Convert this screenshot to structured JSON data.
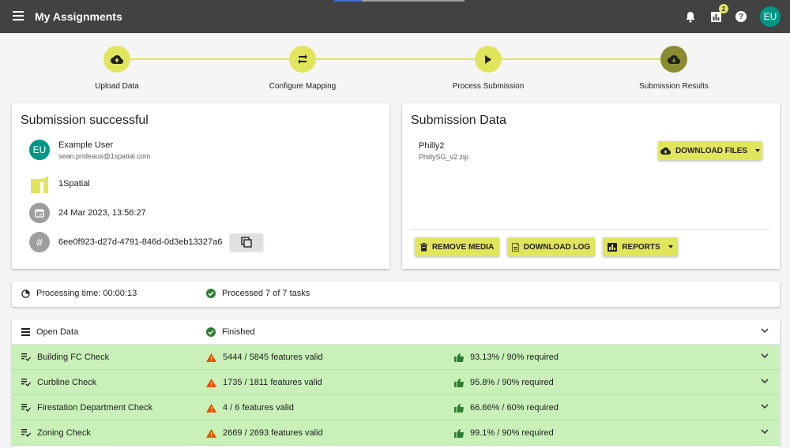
{
  "app": {
    "title": "My Assignments",
    "notification_count": "2",
    "help_symbol": "?",
    "user_initials": "EU"
  },
  "stepper": {
    "steps": [
      {
        "label": "Upload Data",
        "icon": "cloud-upload-icon"
      },
      {
        "label": "Configure Mapping",
        "icon": "swap-arrows-icon"
      },
      {
        "label": "Process Submission",
        "icon": "play-icon"
      },
      {
        "label": "Submission Results",
        "icon": "cloud-download-icon"
      }
    ],
    "active_index": 3
  },
  "summary": {
    "title": "Submission successful",
    "user_initials": "EU",
    "user_name": "Example User",
    "user_email": "sean.prideaux@1spatial.com",
    "organisation": "1Spatial",
    "timestamp": "24 Mar 2023, 13:56:27",
    "hash_symbol": "#",
    "submission_id": "6ee0f923-d27d-4791-846d-0d3eb13327a6"
  },
  "submission_data": {
    "title": "Submission Data",
    "name": "Philly2",
    "file": "PhillySG_v2.zip",
    "download_files_label": "DOWNLOAD FILES",
    "remove_media_label": "REMOVE MEDIA",
    "download_log_label": "DOWNLOAD LOG",
    "reports_label": "REPORTS"
  },
  "processing": {
    "time_label": "Processing time: 00:00:13",
    "tasks_label": "Processed 7 of 7 tasks"
  },
  "tasks": [
    {
      "name": "Open Data",
      "status": "Finished",
      "result": ""
    },
    {
      "name": "Building FC Check",
      "status": "5444 / 5845 features valid",
      "result": "93.13% / 90% required"
    },
    {
      "name": "Curbline Check",
      "status": "1735 / 1811 features valid",
      "result": "95.8% / 90% required"
    },
    {
      "name": "Firestation Department Check",
      "status": "4 / 6 features valid",
      "result": "66.66% / 60% required"
    },
    {
      "name": "Zoning Check",
      "status": "2669 / 2693 features valid",
      "result": "99.1% / 90% required"
    }
  ],
  "colors": {
    "accent": "#e1e55b",
    "topbar": "#424242",
    "success_row": "#c8f0b8",
    "success_icon": "#2e7d32",
    "warning_icon": "#e65100",
    "avatar": "#009688"
  }
}
